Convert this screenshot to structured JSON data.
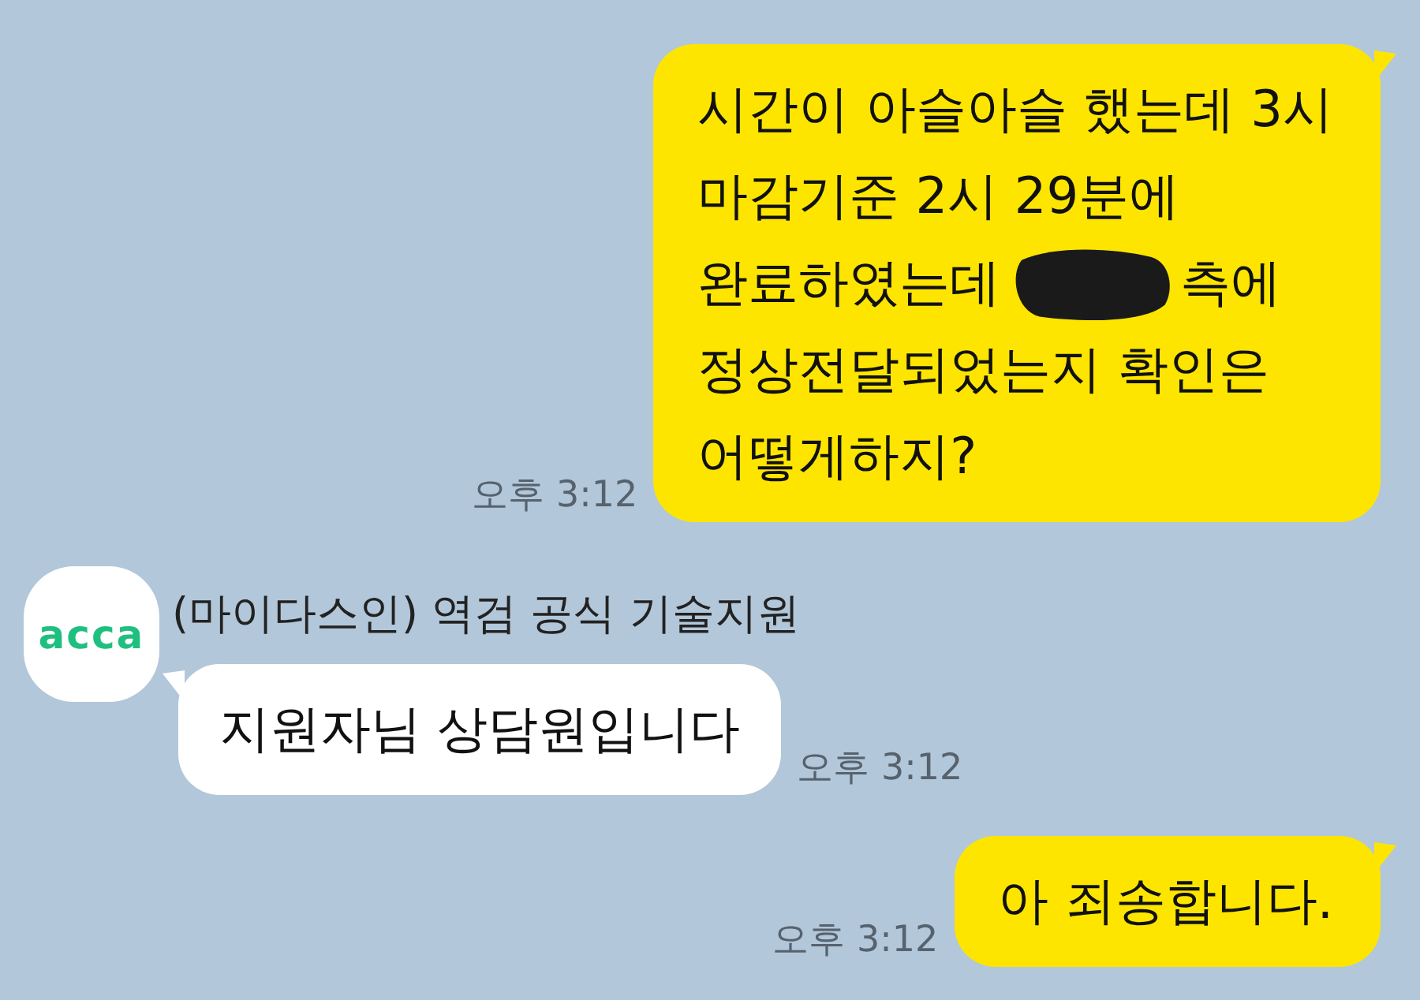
{
  "messages": [
    {
      "kind": "outgoing",
      "lines": [
        {
          "text": "시간이 아슬아슬 했는데 3시",
          "redacted": false
        },
        {
          "text": "마감기준 2시 29분에",
          "redacted": false
        },
        {
          "text": "완료하였는데",
          "redacted": true,
          "after": "측에"
        },
        {
          "text": "정상전달되었는지 확인은",
          "redacted": false
        },
        {
          "text": "어떻게하지?",
          "redacted": false
        }
      ],
      "time": "오후 3:12"
    },
    {
      "kind": "incoming",
      "sender": {
        "name": "(마이다스인) 역검 공식 기술지원",
        "avatar_text": "acca"
      },
      "lines": [
        {
          "text": "지원자님 상담원입니다",
          "redacted": false
        }
      ],
      "time": "오후 3:12"
    },
    {
      "kind": "outgoing",
      "lines": [
        {
          "text": "아 죄송합니다.",
          "redacted": false
        }
      ],
      "time": "오후 3:12"
    }
  ]
}
